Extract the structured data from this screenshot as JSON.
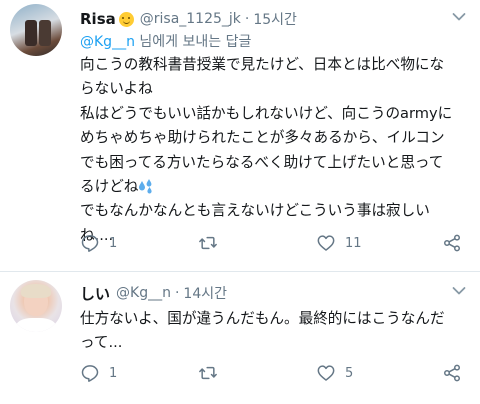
{
  "tweets": [
    {
      "name": "Risa",
      "handle": "@risa_1125_jk",
      "dot": "·",
      "time": "15시간",
      "reply_to_mention": "@Kg__n",
      "reply_to_suffix": " 님에게 보내는 답글",
      "lines": [
        "向こうの教科書昔授業で見たけど、日本とは比べ物にな",
        "らないよね",
        "私はどうでもいい話かもしれないけど、向こうのarmyに",
        "めちゃめちゃ助けられたことが多々あるから、イルコン",
        "でも困ってる方いたらなるべく助けて上げたいと思って",
        "るけどね",
        "でもなんかなんとも言えないけどこういう事は寂しい",
        "ね...."
      ],
      "reply_count": "1",
      "retweet_count": "",
      "like_count": "11"
    },
    {
      "name": "しい",
      "handle": "@Kg__n",
      "dot": "·",
      "time": "14시간",
      "lines": [
        "仕方ないよ、国が違うんだもん。最終的にはこうなんだ",
        "って..."
      ],
      "reply_count": "1",
      "retweet_count": "",
      "like_count": "5"
    }
  ],
  "icons": {
    "reply": "reply-icon",
    "retweet": "retweet-icon",
    "like": "heart-icon",
    "share": "share-icon",
    "more": "chevron-down-icon",
    "emoji": "smiling-face-emoji",
    "sweat": "sweat-droplets-emoji"
  },
  "colors": {
    "text": "#14171a",
    "secondary": "#657786",
    "link": "#1da1f2",
    "divider": "#e1e8ed",
    "icon": "#657786"
  }
}
